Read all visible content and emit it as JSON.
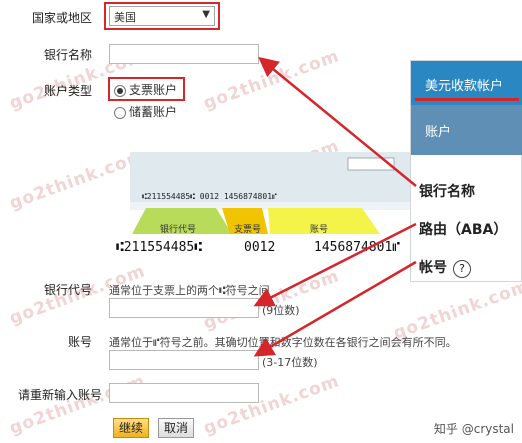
{
  "form": {
    "country_label": "国家或地区",
    "country_value": "美国",
    "bank_name_label": "银行名称",
    "account_type_label": "账户类型",
    "account_type_options": [
      "支票账户",
      "储蓄账户"
    ],
    "routing_label": "银行代号",
    "routing_hint": "通常位于支票上的两个⑆符号之间",
    "routing_digits": "(9位数)",
    "account_label": "账号",
    "account_hint": "通常位于⑈符号之前。其确切位置和数字位数在各银行之间会有所不同。",
    "account_digits": "(3-17位数)",
    "reenter_label": "请重新输入账号",
    "continue_button": "继续",
    "cancel_button": "取消"
  },
  "check": {
    "micr_small": "⑆211554485⑆  0012  1456874801⑈",
    "routing_tab": "银行代号",
    "check_tab": "支票号",
    "account_tab": "账号",
    "micr_routing": "⑆211554485⑆",
    "micr_check": "0012",
    "micr_account": "1456874801⑈"
  },
  "panel": {
    "header": "美元收款帐户",
    "sub": "账户",
    "row1": "银行名称",
    "row2": "路由（ABA）",
    "row3": "帐号",
    "help": "?"
  },
  "watermark": "go2think.com",
  "credit": "知乎 @crystal",
  "colors": {
    "annotation_red": "#d6262b",
    "panel_blue": "#2b87c2",
    "panel_sub_blue": "#5f8fb4"
  }
}
